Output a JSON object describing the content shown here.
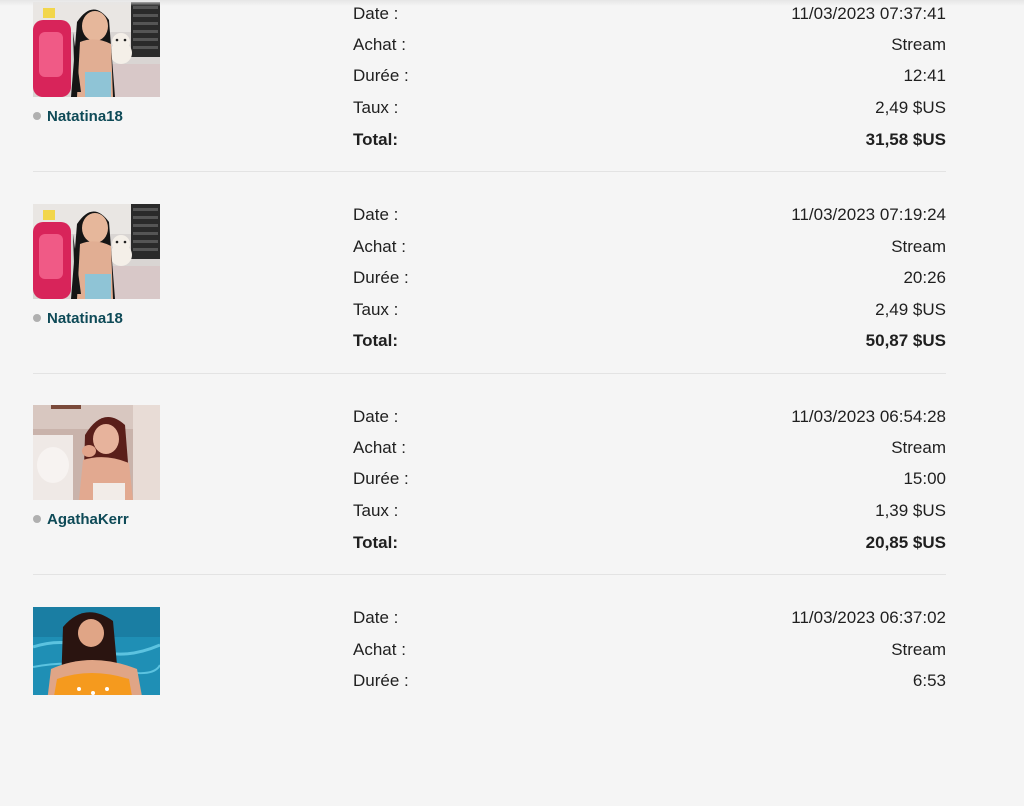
{
  "transactions": [
    {
      "model": "Natatina18",
      "photo": "girl-pink-chair",
      "rows": [
        {
          "label": "Date :",
          "value": "11/03/2023 07:37:41"
        },
        {
          "label": "Achat :",
          "value": "Stream"
        },
        {
          "label": "Durée :",
          "value": "12:41"
        },
        {
          "label": "Taux :",
          "value": "2,49 $US"
        },
        {
          "label": "Total:",
          "value": "31,58 $US"
        }
      ]
    },
    {
      "model": "Natatina18",
      "photo": "girl-pink-chair",
      "rows": [
        {
          "label": "Date :",
          "value": "11/03/2023 07:19:24"
        },
        {
          "label": "Achat :",
          "value": "Stream"
        },
        {
          "label": "Durée :",
          "value": "20:26"
        },
        {
          "label": "Taux :",
          "value": "2,49 $US"
        },
        {
          "label": "Total:",
          "value": "50,87 $US"
        }
      ]
    },
    {
      "model": "AgathaKerr",
      "photo": "girl-blowing-kiss",
      "rows": [
        {
          "label": "Date :",
          "value": "11/03/2023 06:54:28"
        },
        {
          "label": "Achat :",
          "value": "Stream"
        },
        {
          "label": "Durée :",
          "value": "15:00"
        },
        {
          "label": "Taux :",
          "value": "1,39 $US"
        },
        {
          "label": "Total:",
          "value": "20,85 $US"
        }
      ]
    },
    {
      "model": "",
      "photo": "girl-pool",
      "rows": [
        {
          "label": "Date :",
          "value": "11/03/2023 06:37:02"
        },
        {
          "label": "Achat :",
          "value": "Stream"
        },
        {
          "label": "Durée :",
          "value": "6:53"
        }
      ]
    }
  ],
  "colors": {
    "background": "#f5f5f5",
    "model_name": "#0e4a57",
    "status_offline": "#b0b0b0",
    "separator": "#e3e3e3"
  }
}
